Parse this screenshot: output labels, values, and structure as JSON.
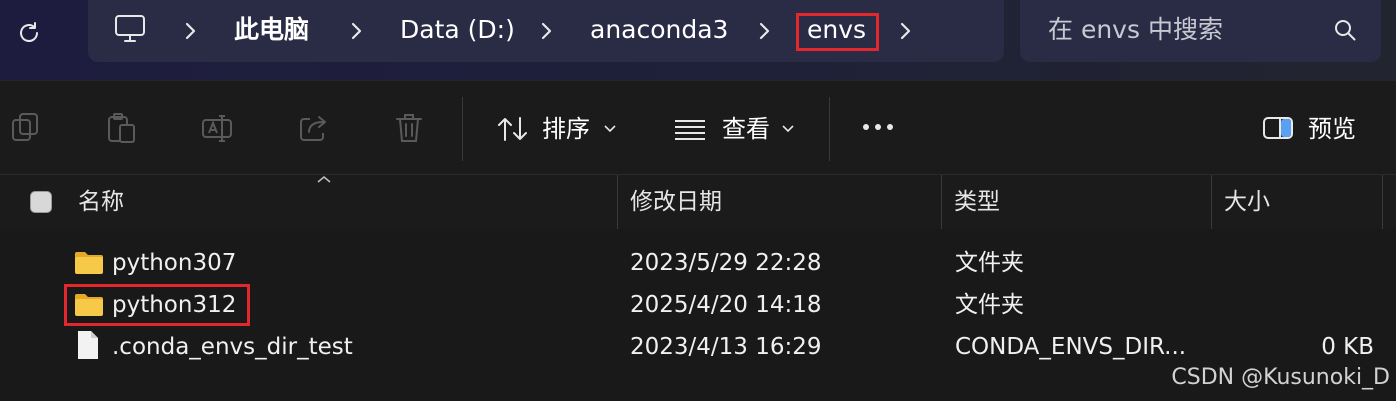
{
  "breadcrumb": {
    "items": [
      "此电脑",
      "Data (D:)",
      "anaconda3",
      "envs"
    ],
    "computer_icon": "monitor-icon",
    "separator_icon": "chevron-right-icon"
  },
  "search": {
    "placeholder": "在 envs 中搜索",
    "icon": "search-icon"
  },
  "toolbar": {
    "disabled_icons": [
      "copy-icon",
      "paste-icon",
      "rename-icon",
      "share-icon",
      "delete-icon"
    ],
    "sort_label": "排序",
    "view_label": "查看",
    "more_label": "•••",
    "preview_label": "预览"
  },
  "columns": {
    "name": "名称",
    "date": "修改日期",
    "type": "类型",
    "size": "大小"
  },
  "files": [
    {
      "name": "python307",
      "date": "2023/5/29 22:28",
      "type": "文件夹",
      "size": "",
      "icon": "folder-icon"
    },
    {
      "name": "python312",
      "date": "2025/4/20 14:18",
      "type": "文件夹",
      "size": "",
      "icon": "folder-icon"
    },
    {
      "name": ".conda_envs_dir_test",
      "date": "2023/4/13 16:29",
      "type": "CONDA_ENVS_DIR...",
      "size": "0 KB",
      "icon": "file-icon"
    }
  ],
  "watermark": "CSDN @Kusunoki_D",
  "colors": {
    "highlight": "#e4262d",
    "folder": "#f7c948",
    "background": "#191919",
    "address_bar": "#2a2b45"
  }
}
